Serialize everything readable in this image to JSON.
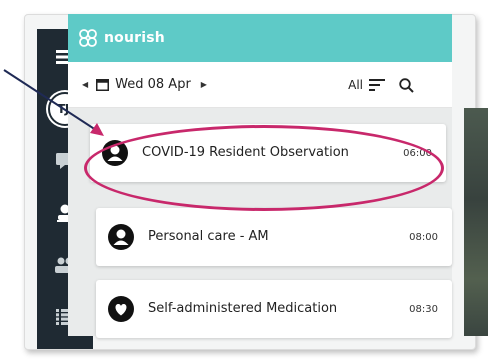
{
  "app": {
    "brand": "nourish",
    "brand_color": "#5ecac7",
    "sidebar_color": "#1f2a33",
    "highlight_color": "#c8286b"
  },
  "sidebar": {
    "avatar_initials": "TJJ",
    "icons": [
      "menu-icon",
      "avatar",
      "chat-icon",
      "person-icon",
      "people-icon",
      "list-icon"
    ]
  },
  "datebar": {
    "date": "Wed 08 Apr",
    "filter_label": "All"
  },
  "tasks": [
    {
      "title": "COVID-19 Resident Observation",
      "time": "06:00",
      "icon": "person-icon"
    },
    {
      "title": "Personal care - AM",
      "time": "08:00",
      "icon": "person-icon"
    },
    {
      "title": "Self-administered Medication",
      "time": "08:30",
      "icon": "heart-icon"
    }
  ]
}
